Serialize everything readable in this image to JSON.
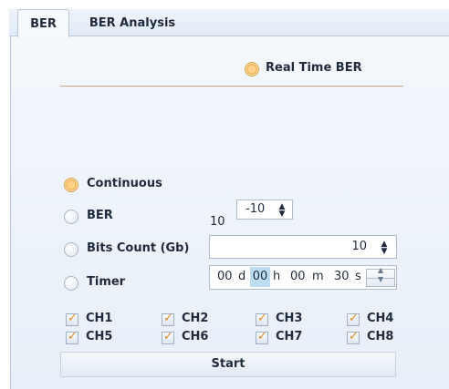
{
  "tabs": [
    {
      "label": "BER",
      "active": true
    },
    {
      "label": "BER Analysis",
      "active": false
    }
  ],
  "mode": {
    "real_time_label": "Real Time BER",
    "selected": true
  },
  "options": [
    {
      "label": "Continuous",
      "selected": true
    },
    {
      "label": "BER",
      "selected": false
    },
    {
      "label": "Bits Count (Gb)",
      "selected": false
    },
    {
      "label": "Timer",
      "selected": false
    }
  ],
  "ber": {
    "base": "10",
    "exponent": "-10"
  },
  "bits_count": {
    "value": "10"
  },
  "timer": {
    "days": "00",
    "days_unit": "d",
    "hours": "00",
    "hours_unit": "h",
    "minutes": "00",
    "minutes_unit": "m",
    "seconds": "30",
    "seconds_unit": "s"
  },
  "channels": [
    {
      "label": "CH1",
      "checked": true
    },
    {
      "label": "CH2",
      "checked": true
    },
    {
      "label": "CH3",
      "checked": true
    },
    {
      "label": "CH4",
      "checked": true
    },
    {
      "label": "CH5",
      "checked": true
    },
    {
      "label": "CH6",
      "checked": true
    },
    {
      "label": "CH7",
      "checked": true
    },
    {
      "label": "CH8",
      "checked": true
    }
  ],
  "start_label": "Start",
  "colors": {
    "radio_selected": "#f5b04a",
    "separator": "#c9a077",
    "check_tick": "#e58a1f"
  }
}
